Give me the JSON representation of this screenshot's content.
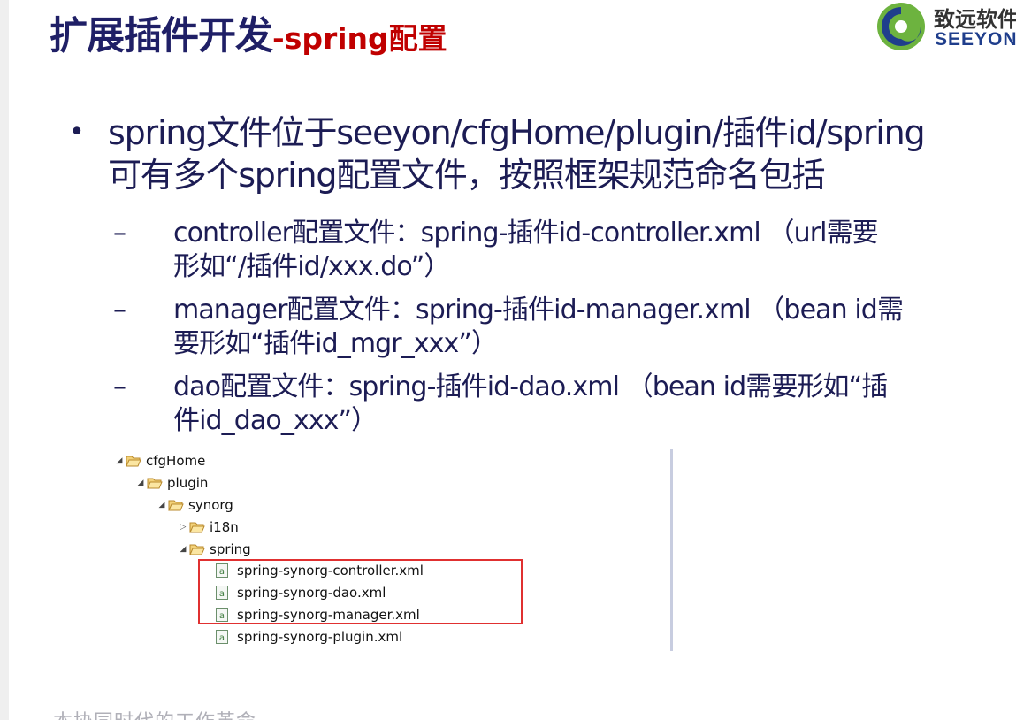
{
  "slide": {
    "title_main": "扩展插件开发",
    "title_sub": "-spring配置",
    "logo": {
      "cn": "致远软件",
      "en": "SEEYON",
      "colors": {
        "green": "#6db33f",
        "blue": "#1f3e8c"
      }
    },
    "bullet": {
      "line1": "spring文件位于seeyon/cfgHome/plugin/插件id/spring",
      "line2": "可有多个spring配置文件，按照框架规范命名包括"
    },
    "subitems": [
      {
        "dash": "–",
        "line1": "controller配置文件：spring-插件id-controller.xml （url需要",
        "line2": "形如“/插件id/xxx.do”）"
      },
      {
        "dash": "–",
        "line1": "manager配置文件：spring-插件id-manager.xml （bean id需",
        "line2": "要形如“插件id_mgr_xxx”）"
      },
      {
        "dash": "–",
        "line1": "dao配置文件：spring-插件id-dao.xml （bean id需要形如“插",
        "line2": "件id_dao_xxx”）"
      }
    ],
    "tree": {
      "rows": [
        {
          "label": "cfgHome",
          "twisty": "◢",
          "kind": "folder"
        },
        {
          "label": "plugin",
          "twisty": "◢",
          "kind": "folder"
        },
        {
          "label": "synorg",
          "twisty": "◢",
          "kind": "folder"
        },
        {
          "label": "i18n",
          "twisty": "▷",
          "kind": "folder"
        },
        {
          "label": "spring",
          "twisty": "◢",
          "kind": "folder"
        },
        {
          "label": "spring-synorg-controller.xml",
          "twisty": "",
          "kind": "file"
        },
        {
          "label": "spring-synorg-dao.xml",
          "twisty": "",
          "kind": "file"
        },
        {
          "label": "spring-synorg-manager.xml",
          "twisty": "",
          "kind": "file"
        },
        {
          "label": "spring-synorg-plugin.xml",
          "twisty": "",
          "kind": "file"
        }
      ],
      "highlight_color": "#e03030"
    },
    "footer": "本协同时代的工作革命"
  }
}
